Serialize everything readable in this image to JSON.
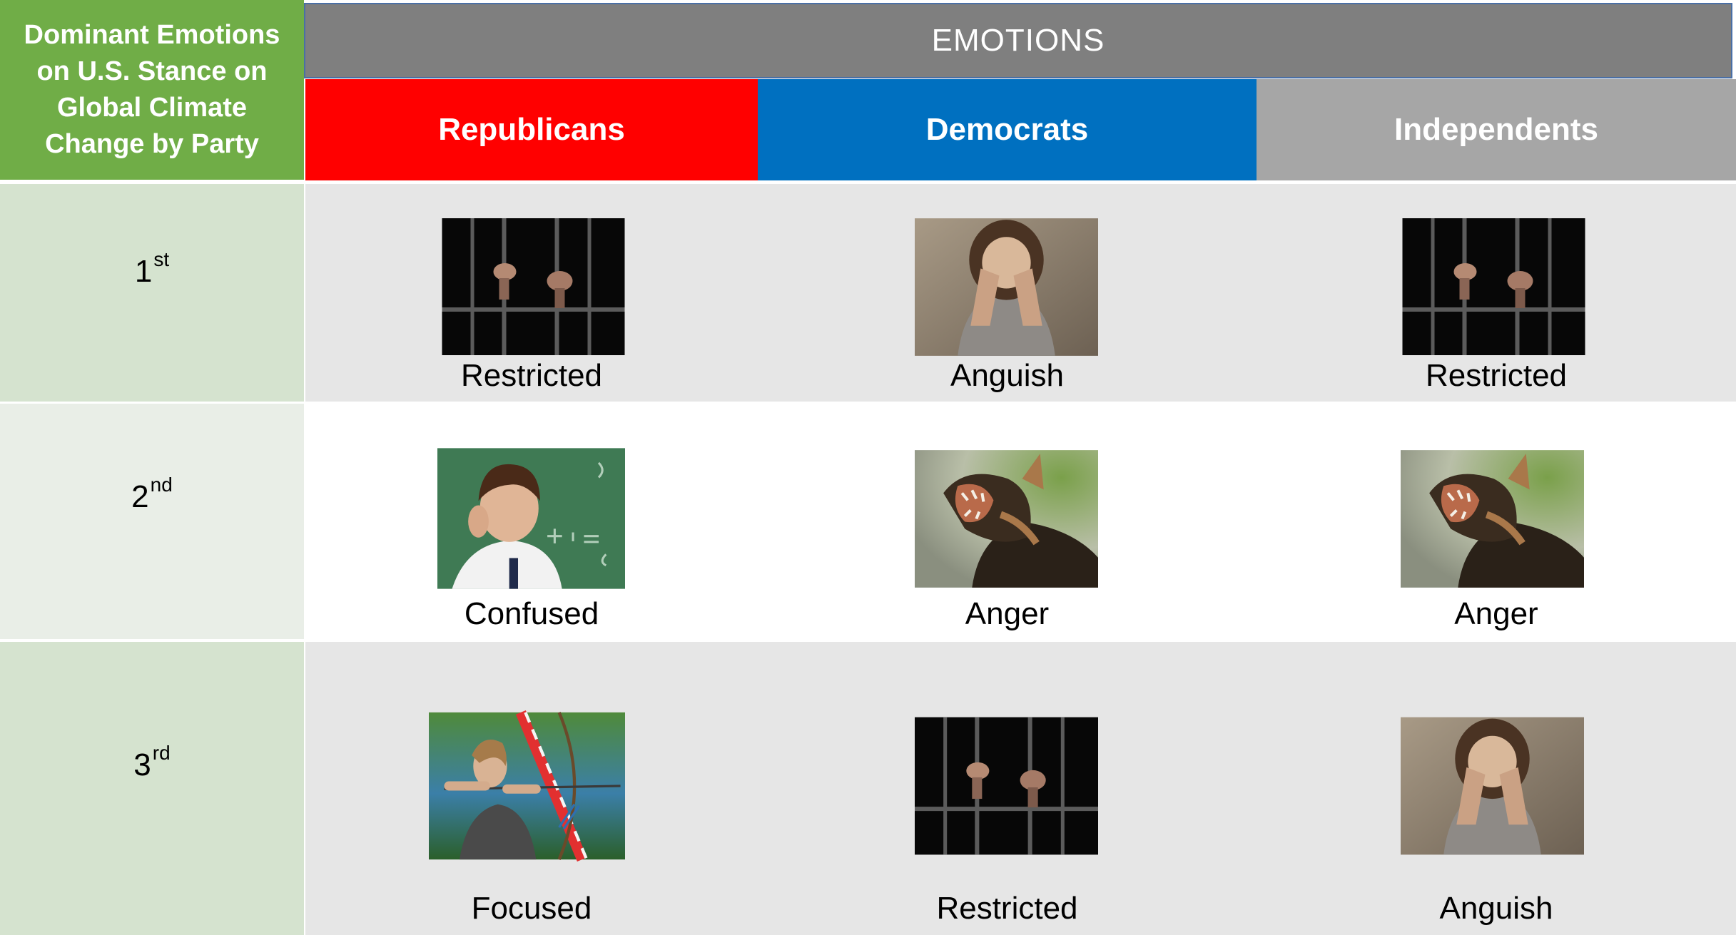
{
  "header": {
    "corner_title": "Dominant Emotions on U.S. Stance on Global Climate Change by Party",
    "emotions_label": "EMOTIONS",
    "parties": [
      "Republicans",
      "Democrats",
      "Independents"
    ],
    "party_colors": [
      "#ff0000",
      "#0070c0",
      "#a6a6a6"
    ]
  },
  "rows": [
    {
      "rank_number": "1",
      "rank_suffix": "st",
      "cells": [
        {
          "emotion": "Restricted",
          "image": "prison-bars-hands-image"
        },
        {
          "emotion": "Anguish",
          "image": "woman-covering-face-image"
        },
        {
          "emotion": "Restricted",
          "image": "prison-bars-hands-image"
        }
      ]
    },
    {
      "rank_number": "2",
      "rank_suffix": "nd",
      "cells": [
        {
          "emotion": "Confused",
          "image": "confused-boy-chalkboard-image"
        },
        {
          "emotion": "Anger",
          "image": "snarling-dog-image"
        },
        {
          "emotion": "Anger",
          "image": "snarling-dog-image"
        }
      ]
    },
    {
      "rank_number": "3",
      "rank_suffix": "rd",
      "cells": [
        {
          "emotion": "Focused",
          "image": "archer-aiming-image"
        },
        {
          "emotion": "Restricted",
          "image": "prison-bars-hands-image"
        },
        {
          "emotion": "Anguish",
          "image": "woman-covering-face-image"
        }
      ]
    }
  ],
  "colors": {
    "corner_bg": "#70ad47",
    "emotions_bg": "#7f7f7f",
    "row_label_bg_1": "#d5e3cf",
    "row_label_bg_2": "#e9eee7",
    "band_gray": "#e6e6e6",
    "band_white": "#ffffff"
  }
}
